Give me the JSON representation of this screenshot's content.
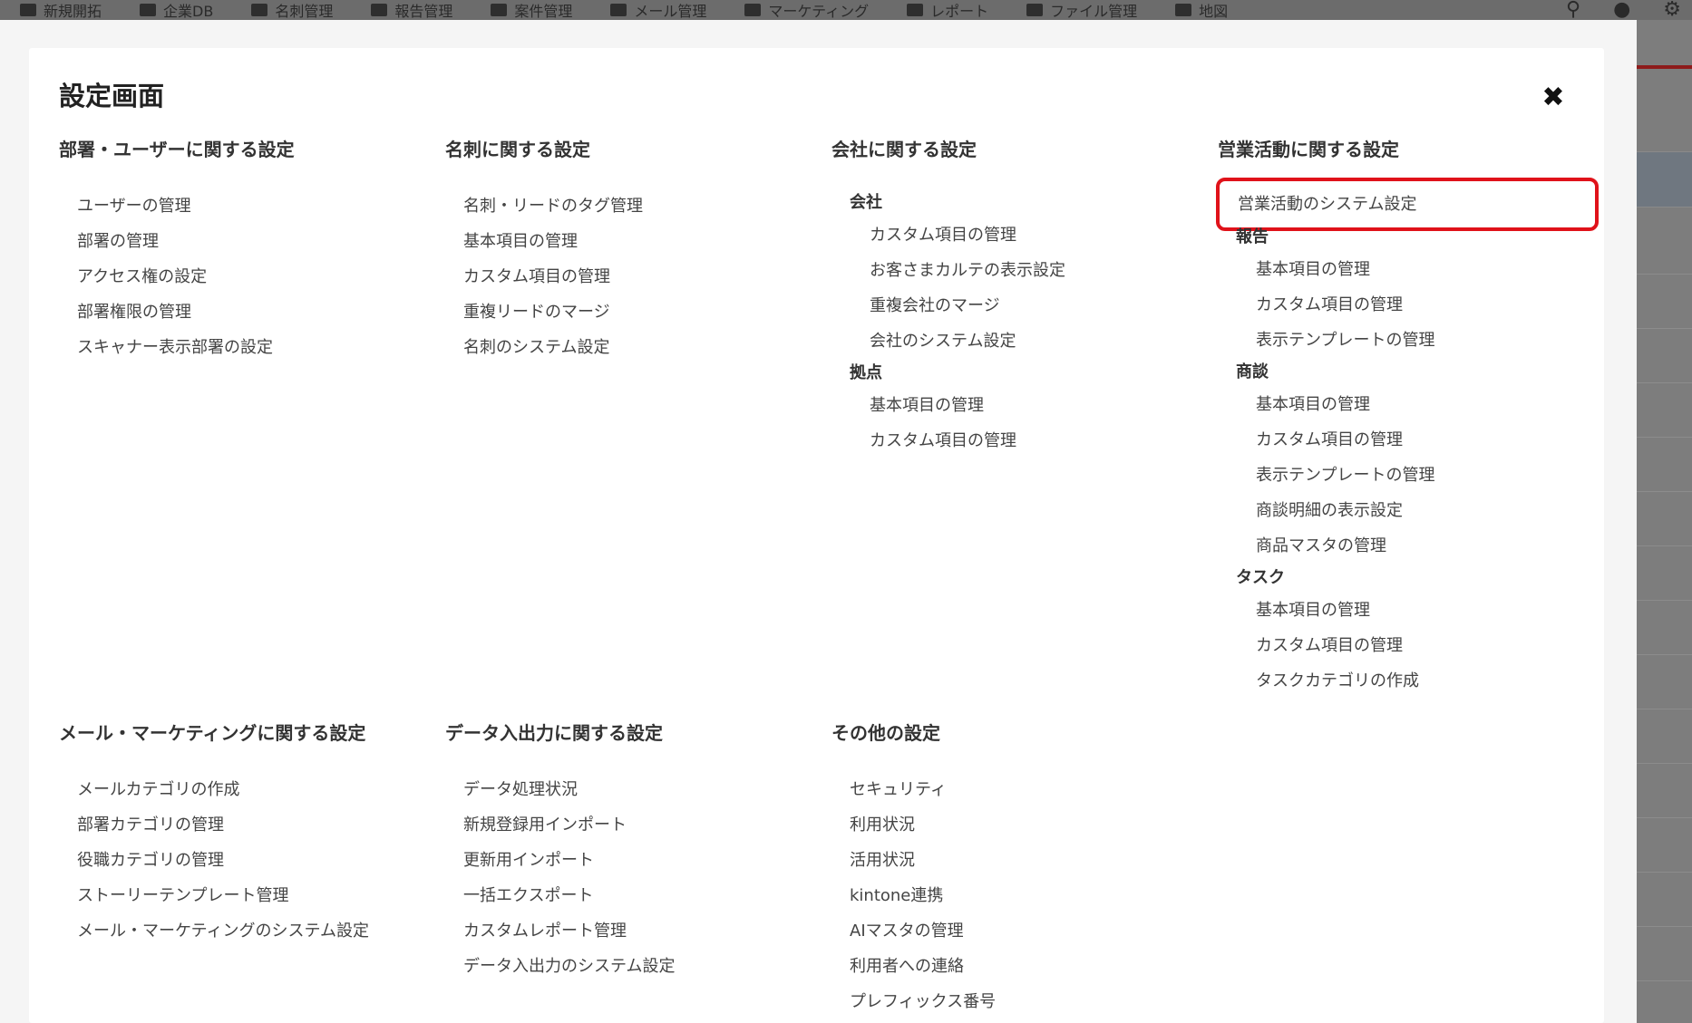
{
  "topbar": {
    "items": [
      "新規開拓",
      "企業DB",
      "名刺管理",
      "報告管理",
      "案件管理",
      "メール管理",
      "マーケティング",
      "レポート",
      "ファイル管理",
      "地図"
    ]
  },
  "modal": {
    "title": "設定画面",
    "close_icon": "close-icon"
  },
  "sections": {
    "dept_user": {
      "heading": "部署・ユーザーに関する設定",
      "links": [
        "ユーザーの管理",
        "部署の管理",
        "アクセス権の設定",
        "部署権限の管理",
        "スキャナー表示部署の設定"
      ]
    },
    "card": {
      "heading": "名刺に関する設定",
      "links": [
        "名刺・リードのタグ管理",
        "基本項目の管理",
        "カスタム項目の管理",
        "重複リードのマージ",
        "名刺のシステム設定"
      ]
    },
    "company": {
      "heading": "会社に関する設定",
      "groups": [
        {
          "label": "会社",
          "links": [
            "カスタム項目の管理",
            "お客さまカルテの表示設定",
            "重複会社のマージ",
            "会社のシステム設定"
          ]
        },
        {
          "label": "拠点",
          "links": [
            "基本項目の管理",
            "カスタム項目の管理"
          ]
        }
      ]
    },
    "sales": {
      "heading": "営業活動に関する設定",
      "top_link": "営業活動のシステム設定",
      "groups": [
        {
          "label": "報告",
          "links": [
            "基本項目の管理",
            "カスタム項目の管理",
            "表示テンプレートの管理"
          ]
        },
        {
          "label": "商談",
          "links": [
            "基本項目の管理",
            "カスタム項目の管理",
            "表示テンプレートの管理",
            "商談明細の表示設定",
            "商品マスタの管理"
          ]
        },
        {
          "label": "タスク",
          "links": [
            "基本項目の管理",
            "カスタム項目の管理",
            "タスクカテゴリの作成"
          ]
        }
      ]
    },
    "mail": {
      "heading": "メール・マーケティングに関する設定",
      "links": [
        "メールカテゴリの作成",
        "部署カテゴリの管理",
        "役職カテゴリの管理",
        "ストーリーテンプレート管理",
        "メール・マーケティングのシステム設定"
      ]
    },
    "data_io": {
      "heading": "データ入出力に関する設定",
      "links": [
        "データ処理状況",
        "新規登録用インポート",
        "更新用インポート",
        "一括エクスポート",
        "カスタムレポート管理",
        "データ入出力のシステム設定"
      ]
    },
    "other": {
      "heading": "その他の設定",
      "links": [
        "セキュリティ",
        "利用状況",
        "活用状況",
        "kintone連携",
        "AIマスタの管理",
        "利用者への連絡",
        "プレフィックス番号"
      ]
    }
  },
  "colors": {
    "highlight_border": "#e0121a",
    "overlay": "#7d7d7d"
  }
}
